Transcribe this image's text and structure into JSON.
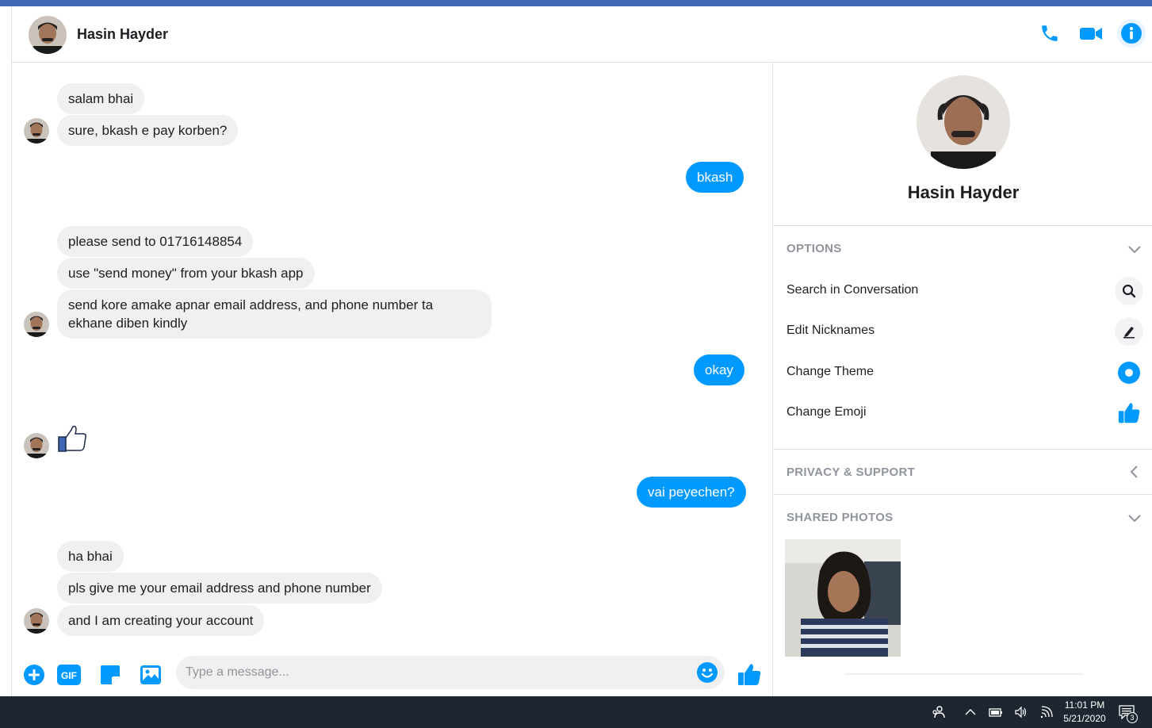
{
  "header": {
    "contact_name": "Hasin Hayder"
  },
  "messages": {
    "m1": "salam bhai",
    "m2": "sure, bkash e pay korben?",
    "m3": "bkash",
    "m4": "please send to 01716148854",
    "m5": "use \"send money\" from your bkash app",
    "m6": "send kore amake apnar email address, and phone number ta ekhane diben kindly",
    "m7": "okay",
    "m8": "vai peyechen?",
    "m9": "ha bhai",
    "m10": "pls give me your email address and phone number",
    "m11": "and I am creating your account"
  },
  "composer": {
    "placeholder": "Type a message...",
    "gif_label": "GIF"
  },
  "sidebar": {
    "name": "Hasin Hayder",
    "options_title": "OPTIONS",
    "options": [
      {
        "label": "Search in Conversation",
        "icon": "search-icon"
      },
      {
        "label": "Edit Nicknames",
        "icon": "pencil-icon"
      },
      {
        "label": "Change Theme",
        "icon": "theme-icon"
      },
      {
        "label": "Change Emoji",
        "icon": "thumbs-up-icon"
      }
    ],
    "privacy_title": "PRIVACY & SUPPORT",
    "shared_title": "SHARED PHOTOS"
  },
  "taskbar": {
    "time": "11:01 PM",
    "date": "5/21/2020",
    "notification_count": "3"
  },
  "colors": {
    "accent": "#0099ff",
    "topbar": "#4267b2",
    "incoming_bubble": "#f1f0f0",
    "taskbar": "#1e2731"
  }
}
